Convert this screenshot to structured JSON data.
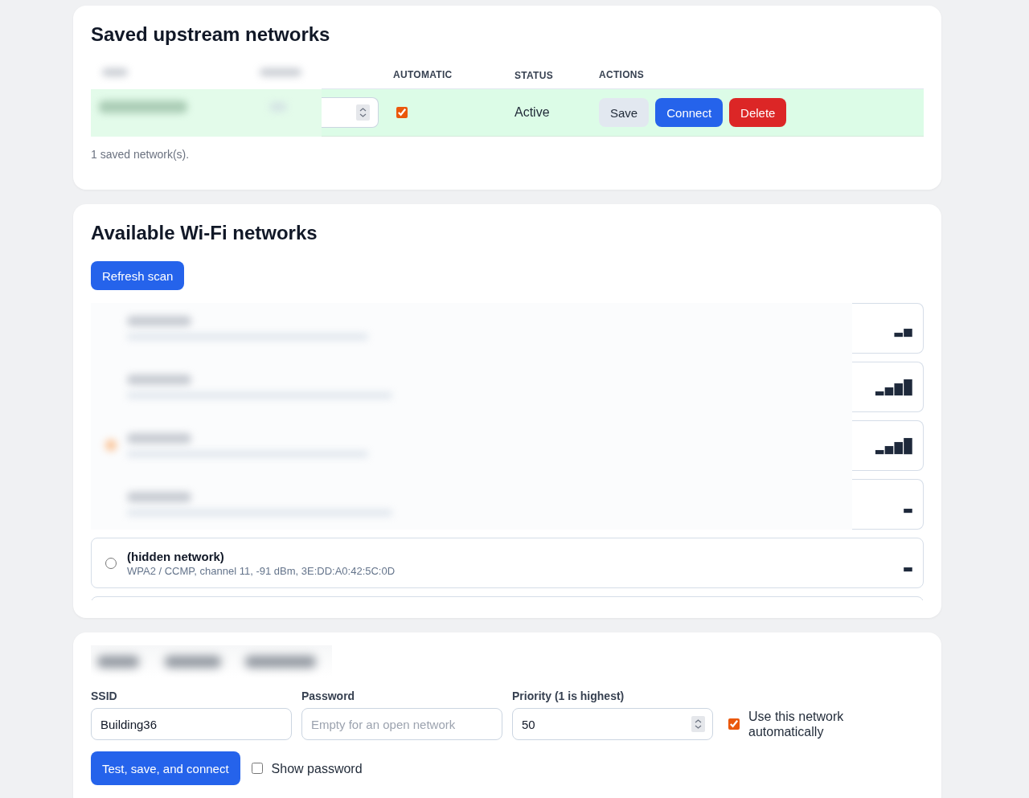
{
  "saved_networks": {
    "title": "Saved upstream networks",
    "table": {
      "columns": [
        "AUTOMATIC",
        "STATUS",
        "ACTIONS"
      ],
      "rows": [
        {
          "current": true,
          "automatic": true,
          "status": "Active",
          "actions": [
            {
              "label": "Save",
              "kind": "secondary"
            },
            {
              "label": "Connect",
              "kind": "primary"
            },
            {
              "label": "Delete",
              "kind": "danger"
            }
          ]
        }
      ]
    },
    "footer": "1 saved network(s)."
  },
  "available_networks": {
    "title": "Available Wi-Fi networks",
    "refresh_button": "Refresh scan",
    "networks": [
      {
        "kind": "blurred",
        "signal": "▂▄"
      },
      {
        "kind": "blurred",
        "signal": "▂▄▆█"
      },
      {
        "kind": "blurred",
        "signal": "▂▄▆█"
      },
      {
        "kind": "blurred",
        "signal": "▂"
      },
      {
        "kind": "full",
        "selected": false,
        "name": "(hidden network)",
        "details": "WPA2 / CCMP, channel 11, -91 dBm, 3E:DD:A0:42:5C:0D",
        "signal": "▂"
      },
      {
        "kind": "clipped"
      }
    ]
  },
  "add_network": {
    "fields": [
      {
        "kind": "text",
        "label": "SSID",
        "value": "Building36"
      },
      {
        "kind": "password",
        "label": "Password",
        "placeholder": "Empty for an open network"
      },
      {
        "kind": "number",
        "label": "Priority (1 is highest)",
        "value": "50"
      }
    ],
    "auto_checkbox": {
      "label": "Use this network automatically",
      "checked": true
    },
    "submit_button": "Test, save, and connect",
    "show_password": {
      "label": "Show password",
      "checked": false
    }
  }
}
